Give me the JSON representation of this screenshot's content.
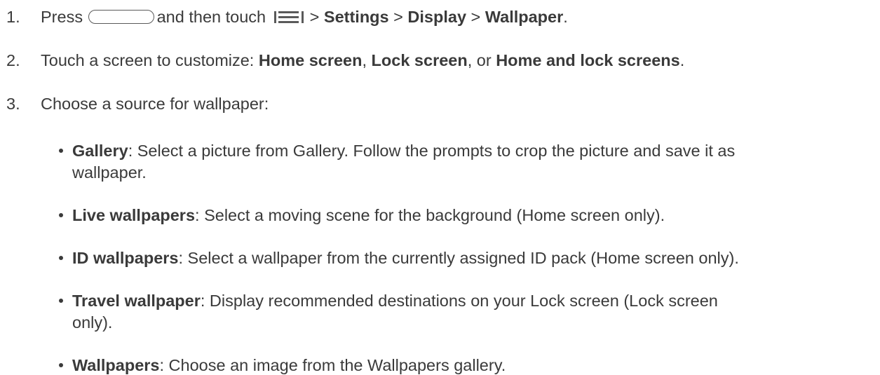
{
  "steps": [
    {
      "number": "1.",
      "press": "Press",
      "then_touch": "and then touch",
      "sep1": ">",
      "settings": "Settings",
      "sep2": ">",
      "display": "Display",
      "sep3": ">",
      "wallpaper": "Wallpaper",
      "end": "."
    },
    {
      "number": "2.",
      "lead": "Touch a screen to customize: ",
      "opt1": "Home screen",
      "comma1": ", ",
      "opt2": "Lock screen",
      "comma2": ", or ",
      "opt3": "Home and lock screens",
      "end": "."
    },
    {
      "number": "3.",
      "text": "Choose a source for wallpaper:"
    }
  ],
  "sources": [
    {
      "term": "Gallery",
      "desc": ": Select a picture from Gallery. Follow the prompts to crop the picture and save it as",
      "desc_cont": "wallpaper."
    },
    {
      "term": "Live wallpapers",
      "desc": ": Select a moving scene for the background (Home screen only)."
    },
    {
      "term": "ID wallpapers",
      "desc": ": Select a wallpaper from the currently assigned ID pack (Home screen only)."
    },
    {
      "term": "Travel wallpaper",
      "desc": ": Display recommended destinations on your Lock screen (Lock screen",
      "desc_cont": "only)."
    },
    {
      "term": "Wallpapers",
      "desc": ": Choose an image from the Wallpapers gallery."
    }
  ],
  "icons": {
    "home_button": "home-button-icon",
    "menu_key": "menu-key-icon"
  }
}
